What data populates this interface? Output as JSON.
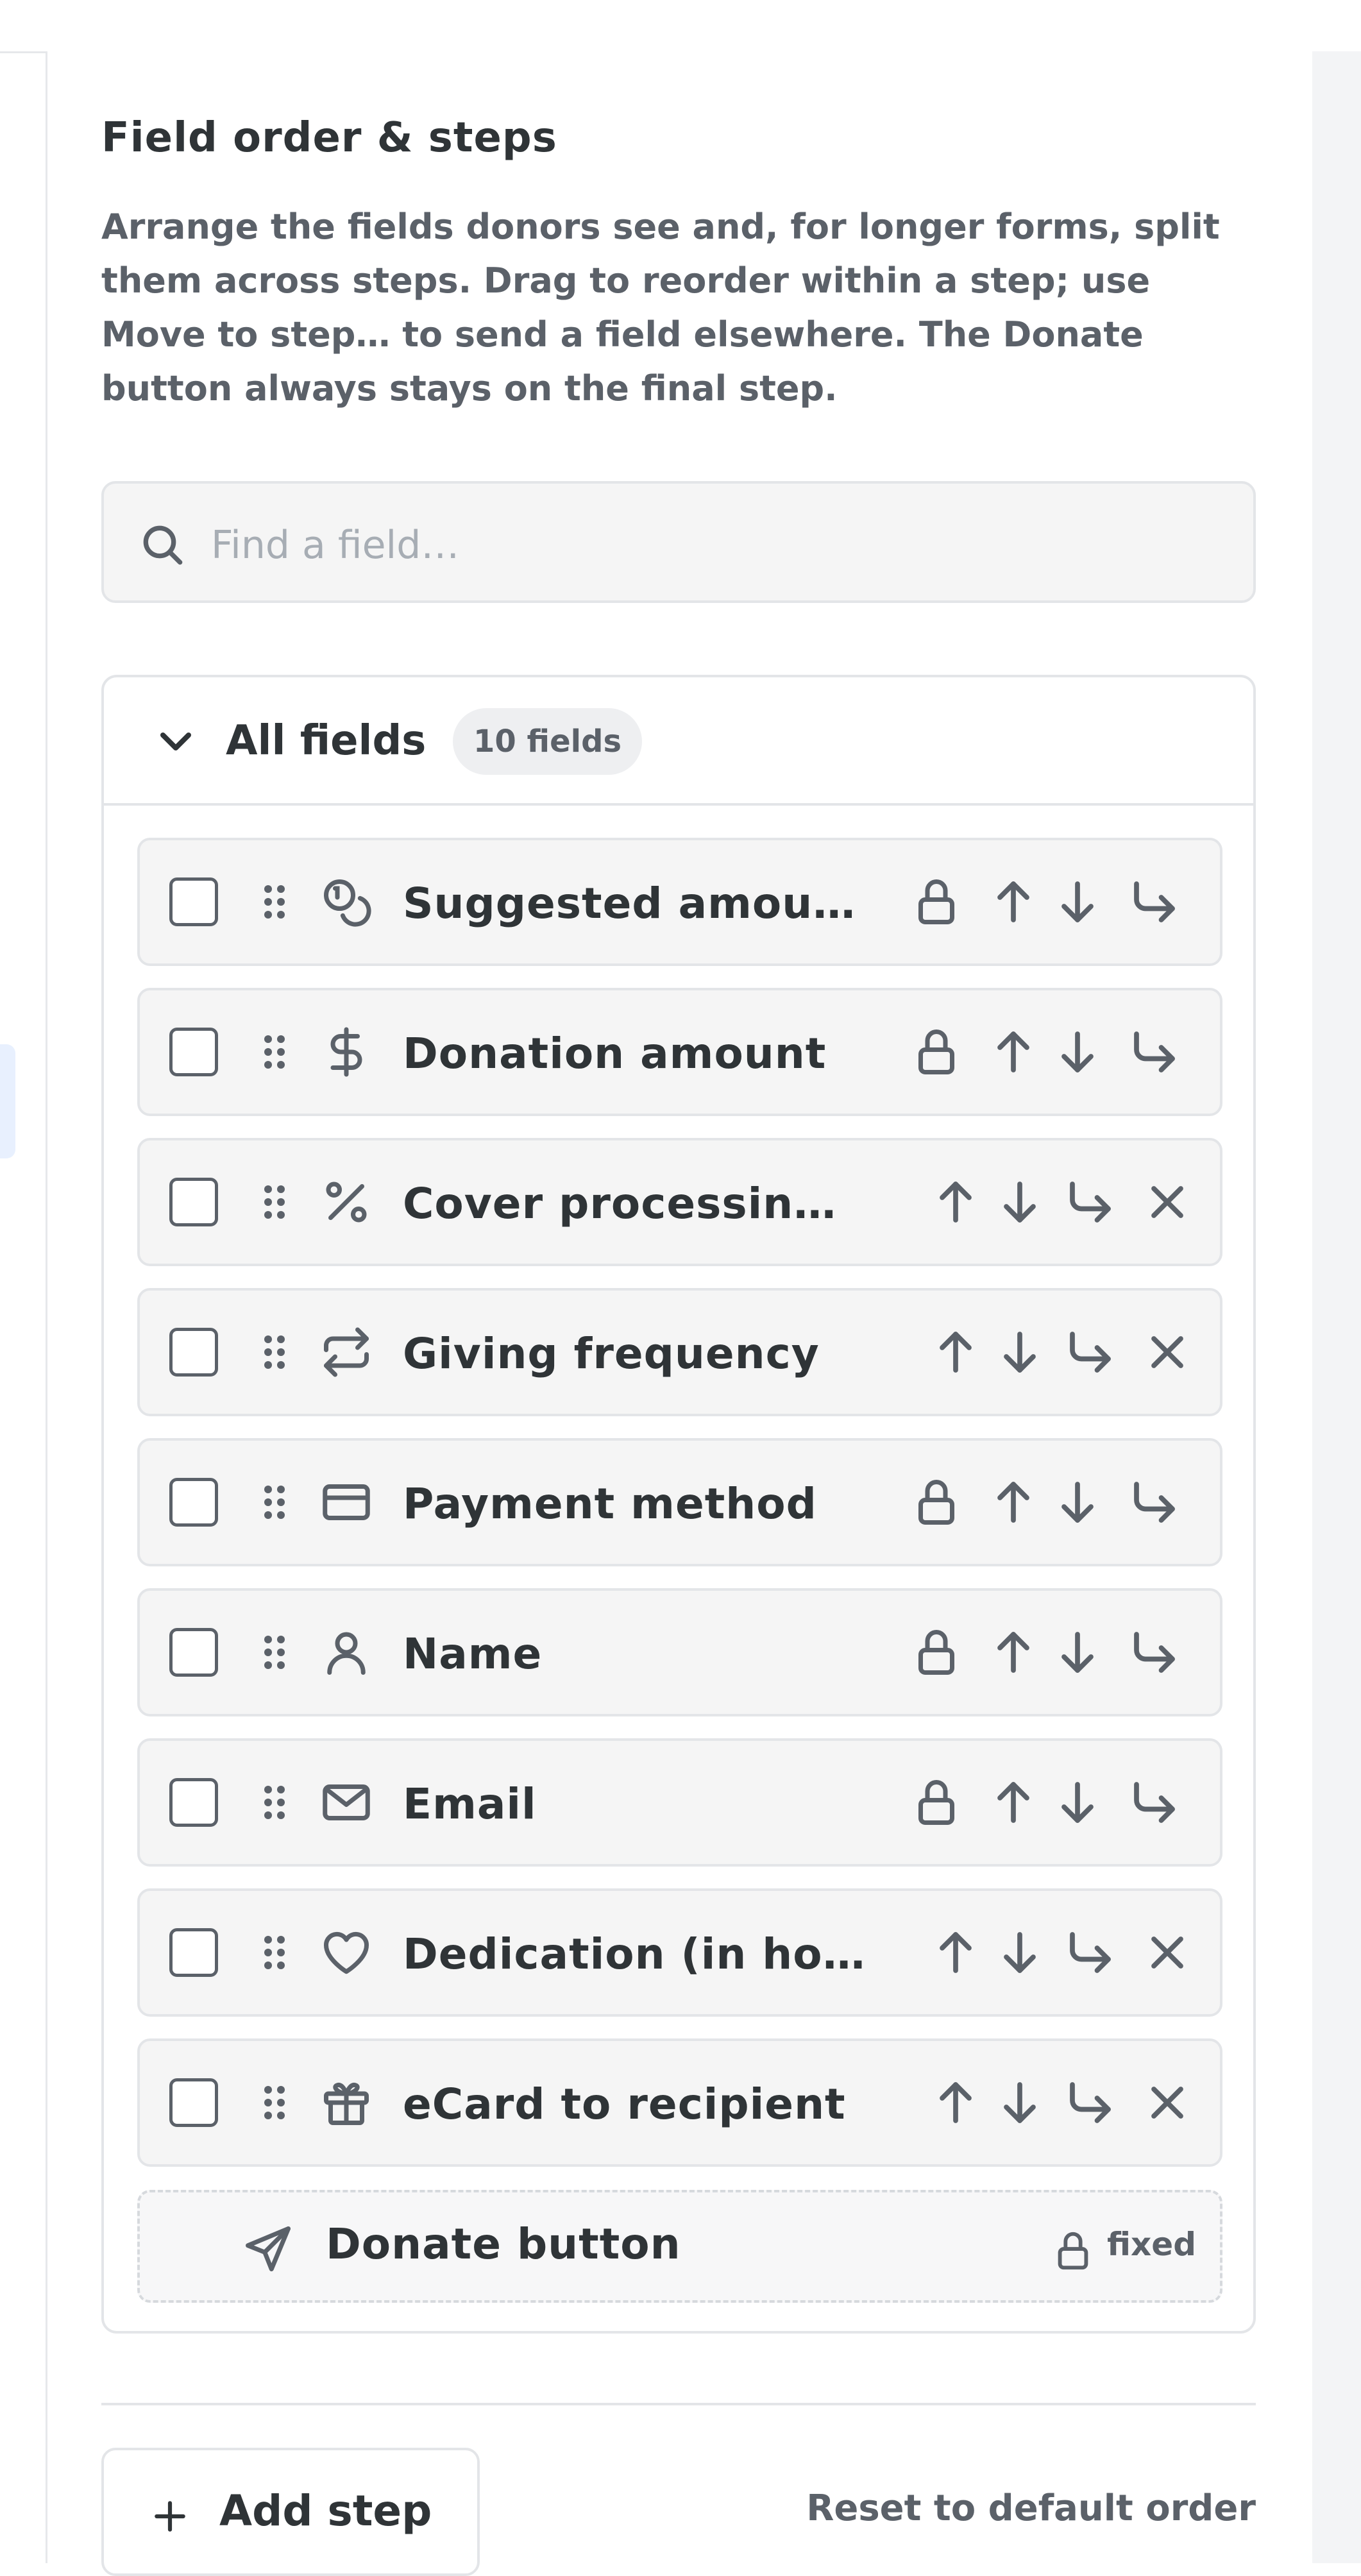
{
  "section": {
    "title": "Field order & steps",
    "description": "Arrange the fields donors see and, for longer forms, split them across steps. Drag to reorder within a step; use Move to step… to send a field elsewhere. The Donate button always stays on the final step."
  },
  "search": {
    "placeholder": "Find a field…",
    "value": ""
  },
  "group": {
    "title": "All fields",
    "count_label": "10 fields",
    "expanded": true
  },
  "fields": [
    {
      "label": "Suggested amounts",
      "icon": "coins-icon",
      "locked": true,
      "removable": false
    },
    {
      "label": "Donation amount",
      "icon": "dollar-icon",
      "locked": true,
      "removable": false
    },
    {
      "label": "Cover processing fees",
      "icon": "percent-icon",
      "locked": false,
      "removable": true
    },
    {
      "label": "Giving frequency",
      "icon": "repeat-icon",
      "locked": false,
      "removable": true
    },
    {
      "label": "Payment method",
      "icon": "credit-card-icon",
      "locked": true,
      "removable": false
    },
    {
      "label": "Name",
      "icon": "user-icon",
      "locked": true,
      "removable": false
    },
    {
      "label": "Email",
      "icon": "mail-icon",
      "locked": true,
      "removable": false
    },
    {
      "label": "Dedication (in honor or memory)",
      "icon": "heart-icon",
      "locked": false,
      "removable": true
    },
    {
      "label": "eCard to recipient",
      "icon": "gift-icon",
      "locked": false,
      "removable": true
    }
  ],
  "donate_row": {
    "label": "Donate button",
    "icon": "send-icon",
    "fixed_label": "fixed"
  },
  "footer": {
    "add_step_label": "Add step",
    "reset_label": "Reset to default order"
  },
  "colors": {
    "text": "#2f3437",
    "muted": "#5b6169",
    "row_bg": "#f5f5f5",
    "border": "#e3e5e8"
  }
}
